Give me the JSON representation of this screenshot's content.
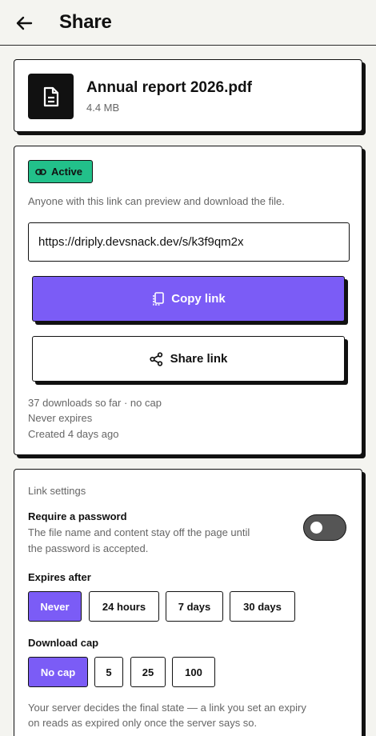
{
  "header": {
    "title": "Share"
  },
  "file": {
    "name": "Annual report 2026.pdf",
    "size": "4.4 MB"
  },
  "link": {
    "status": "Active",
    "description": "Anyone with this link can preview and download the file.",
    "url": "https://driply.devsnack.dev/s/k3f9qm2x",
    "copy_label": "Copy link",
    "share_label": "Share link",
    "downloads": "37 downloads so far · no cap",
    "expiry": "Never expires",
    "created": "Created 4 days ago"
  },
  "settings": {
    "section_title": "Link settings",
    "password": {
      "label": "Require a password",
      "help_line1": "The file name and content stay off the page until",
      "help_line2": "the password is accepted.",
      "enabled": false
    },
    "expires": {
      "label": "Expires after",
      "options": [
        "Never",
        "24 hours",
        "7 days",
        "30 days"
      ],
      "selected": "Never"
    },
    "cap": {
      "label": "Download cap",
      "options": [
        "No cap",
        "5",
        "25",
        "100"
      ],
      "selected": "No cap"
    },
    "footer_line1": "Your server decides the final state — a link you set an expiry",
    "footer_line2": "on reads as expired only once the server says so."
  },
  "colors": {
    "accent": "#7b5cf6",
    "active_badge": "#22c08a",
    "background": "#f4f4f0"
  }
}
